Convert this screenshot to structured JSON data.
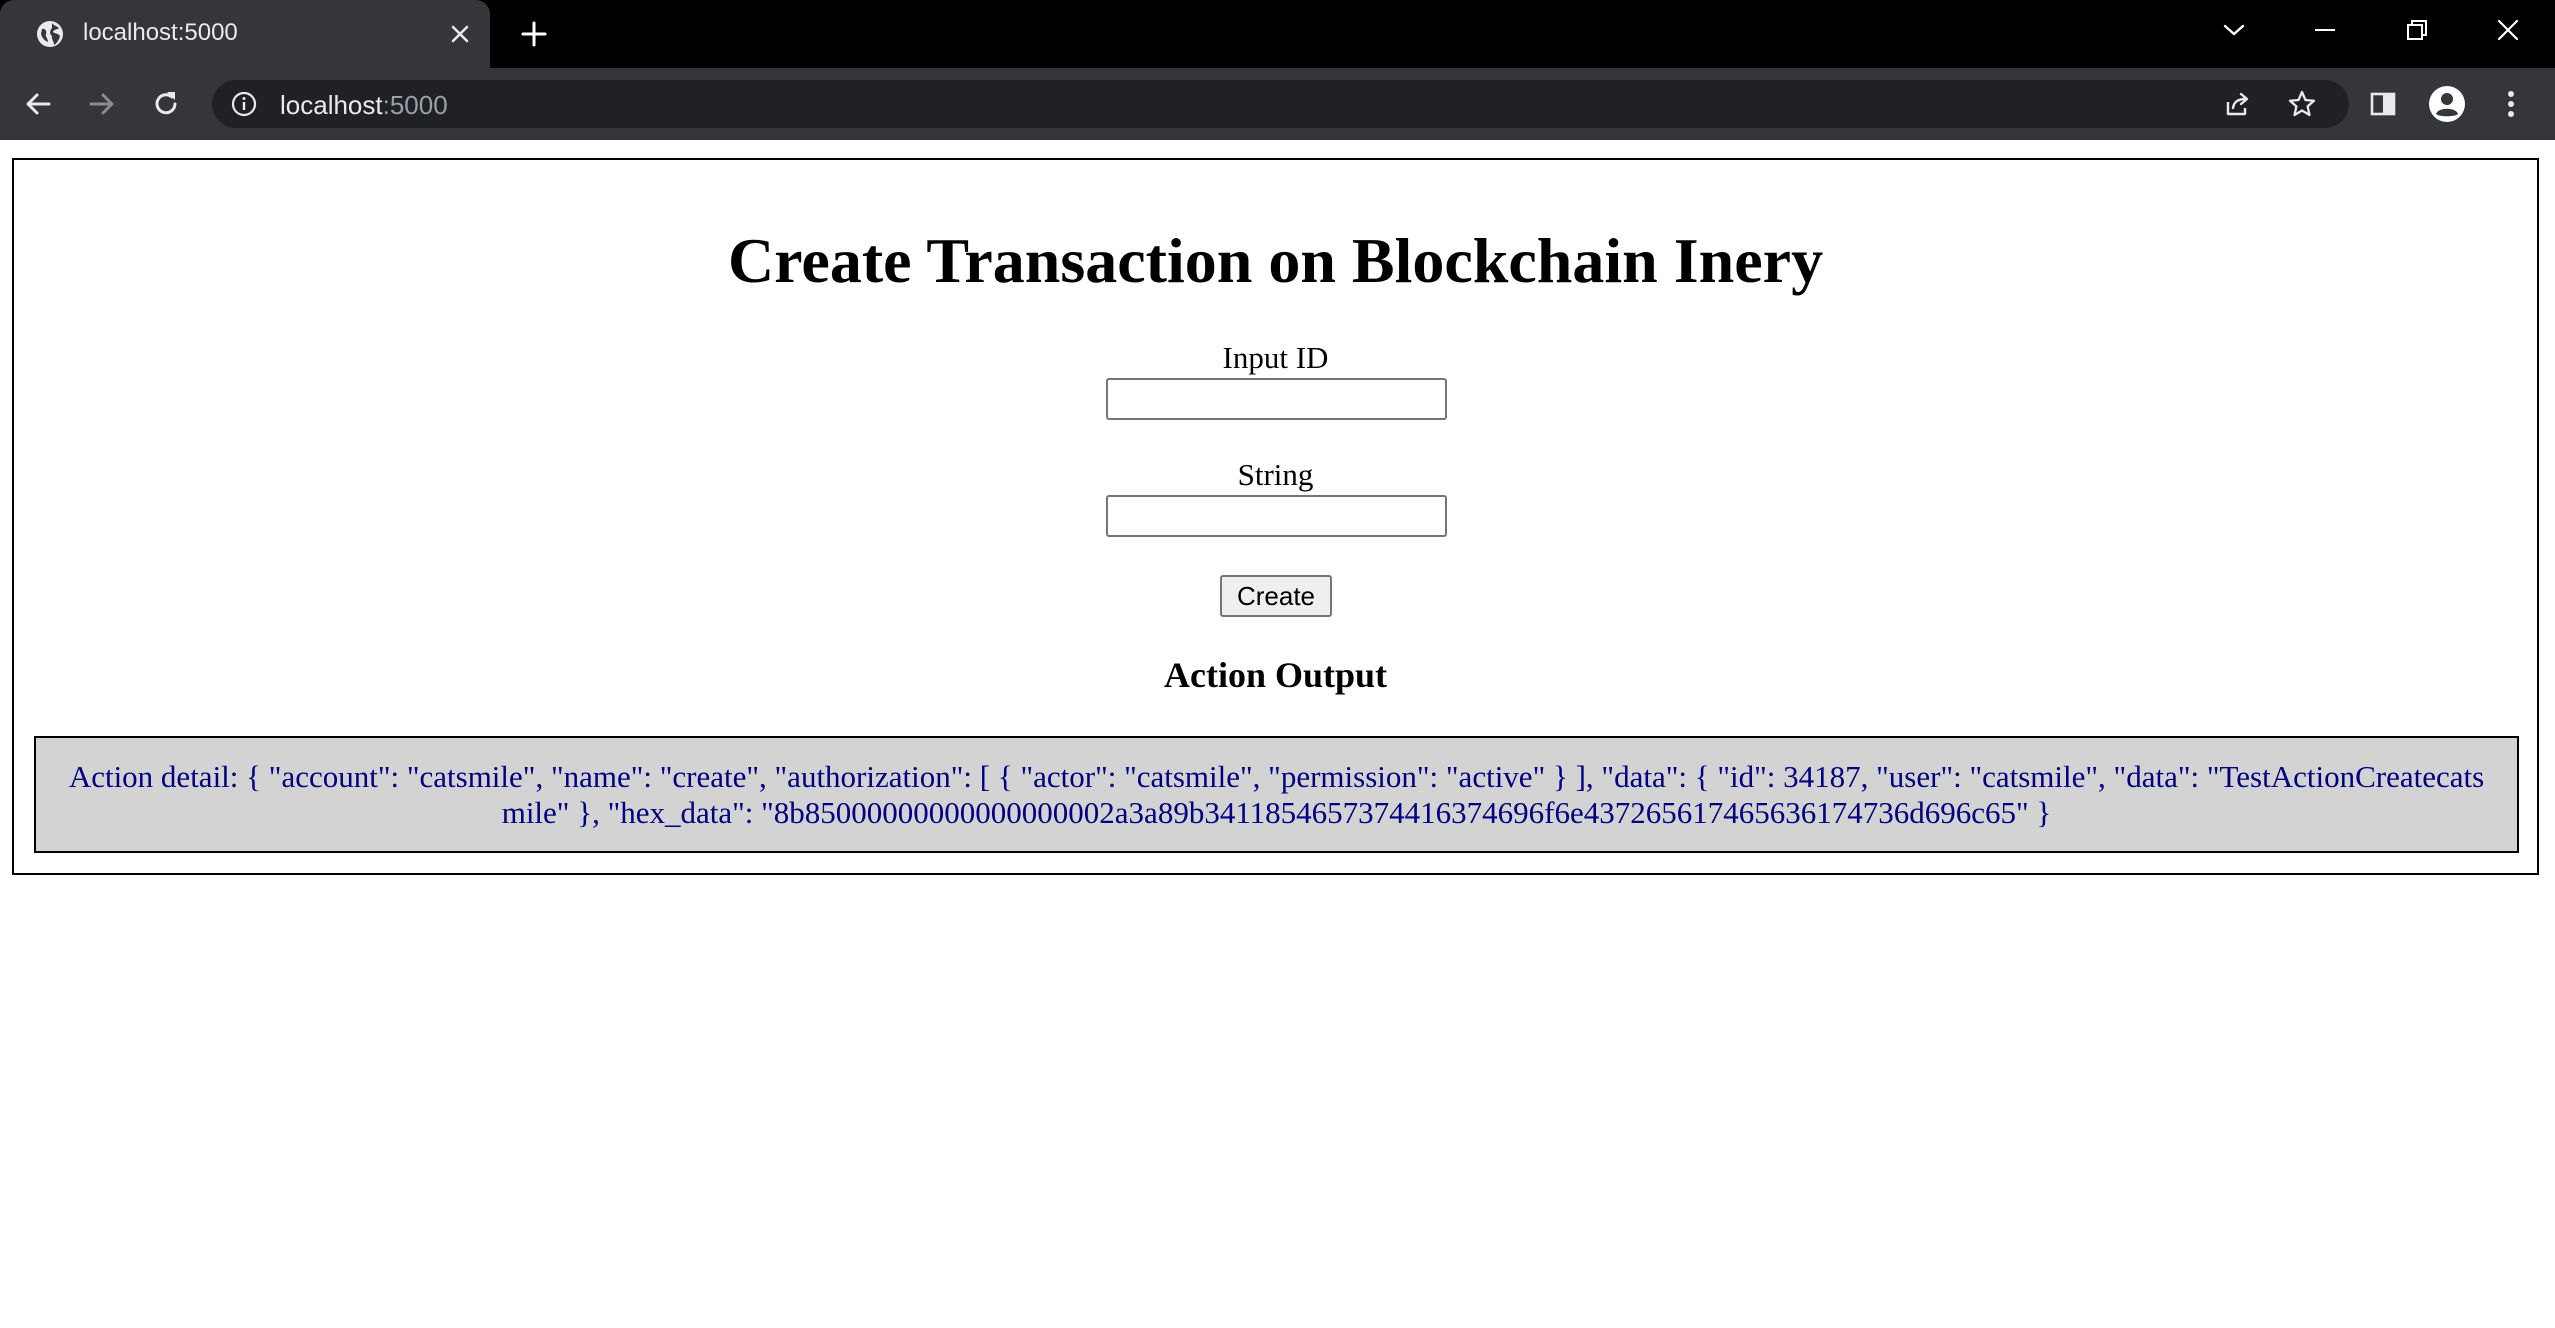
{
  "browser": {
    "tab": {
      "title": "localhost:5000",
      "favicon_icon": "globe-icon"
    },
    "address": {
      "host": "localhost",
      "port": ":5000"
    },
    "colors": {
      "titlebar": "#000000",
      "tab": "#35363a",
      "omnibox": "#202124"
    }
  },
  "page": {
    "title": "Create Transaction on Blockchain Inery",
    "input_id": {
      "label": "Input ID",
      "value": "",
      "placeholder": ""
    },
    "string": {
      "label": "String",
      "value": "",
      "placeholder": ""
    },
    "create_button": "Create",
    "output_heading": "Action Output",
    "output_text": "Action detail: { \"account\": \"catsmile\", \"name\": \"create\", \"authorization\": [ { \"actor\": \"catsmile\", \"permission\": \"active\" } ], \"data\": { \"id\": 34187, \"user\": \"catsmile\", \"data\": \"TestActionCreatecatsmile\" }, \"hex_data\": \"8b85000000000000000002a3a89b3411854657374416374696f6e437265617465636174736d696c65\" }",
    "colors": {
      "output_bg": "#d3d3d3",
      "output_text": "#000080"
    }
  }
}
